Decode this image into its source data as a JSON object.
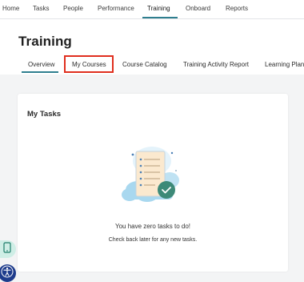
{
  "topnav": {
    "items": [
      "Home",
      "Tasks",
      "People",
      "Performance",
      "Training",
      "Onboard",
      "Reports"
    ],
    "active": "Training"
  },
  "page": {
    "title": "Training"
  },
  "tabs": {
    "items": [
      "Overview",
      "My Courses",
      "Course Catalog",
      "Training Activity Report",
      "Learning Plans"
    ],
    "active": "Overview",
    "highlighted": "My Courses"
  },
  "card": {
    "title": "My Tasks",
    "empty_message": "You have zero tasks to do!",
    "empty_subtext": "Check back later for any new tasks."
  },
  "icons": {
    "mobile": "mobile-phone-icon",
    "accessibility": "accessibility-icon"
  },
  "colors": {
    "accent": "#2f7f8f",
    "highlight_border": "#e02f1f",
    "check_badge": "#3d8a78",
    "accessibility_bg": "#1e3c8c"
  }
}
